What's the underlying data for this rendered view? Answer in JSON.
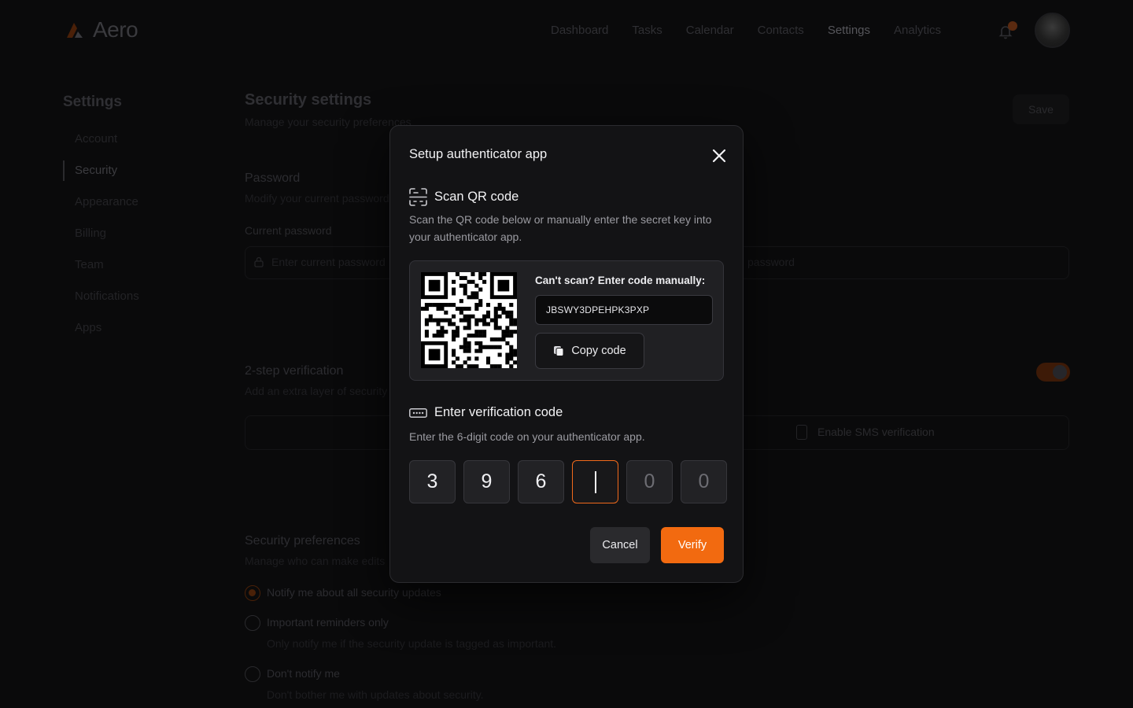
{
  "app": {
    "name": "Aero",
    "accent": "#f26a10"
  },
  "nav": {
    "items": [
      "Dashboard",
      "Tasks",
      "Calendar",
      "Contacts",
      "Settings",
      "Analytics"
    ],
    "active": "Settings",
    "icons": [
      "bell-icon",
      "avatar"
    ]
  },
  "sidebar": {
    "title": "Settings",
    "items": [
      "Account",
      "Security",
      "Appearance",
      "Billing",
      "Team",
      "Notifications",
      "Apps"
    ],
    "active": "Security"
  },
  "page": {
    "title": "Security settings",
    "subtitle": "Manage your security preferences",
    "save_label": "Save"
  },
  "password": {
    "title": "Password",
    "subtitle": "Modify your current password",
    "current_label": "Current password",
    "current_placeholder": "Enter current password",
    "new_placeholder": "password"
  },
  "two_step": {
    "title": "2-step verification",
    "subtitle": "Add an extra layer of security",
    "enabled": true,
    "sms_label": "Enable SMS verification"
  },
  "preferences": {
    "title": "Security preferences",
    "subtitle": "Manage who can make edits",
    "options": [
      {
        "label": "Notify me about all security updates",
        "sub": "",
        "selected": true
      },
      {
        "label": "Important reminders only",
        "sub": "Only notify me if the security update is tagged as important.",
        "selected": false
      },
      {
        "label": "Don't notify me",
        "sub": "Don't bother me with updates about security.",
        "selected": false
      }
    ]
  },
  "modal": {
    "title": "Setup authenticator app",
    "scan": {
      "heading": "Scan QR code",
      "description": "Scan the QR code below or manually enter the secret key into your authenticator app.",
      "manual_label": "Can't scan? Enter code manually:",
      "secret": "JBSWY3DPEHPK3PXP",
      "copy_label": "Copy code"
    },
    "verify": {
      "heading": "Enter verification code",
      "description": "Enter the 6-digit code on your authenticator app.",
      "digits": [
        "3",
        "9",
        "6",
        "",
        "0",
        "0"
      ],
      "active_index": 3,
      "filled_count": 3
    },
    "cancel_label": "Cancel",
    "verify_label": "Verify"
  }
}
